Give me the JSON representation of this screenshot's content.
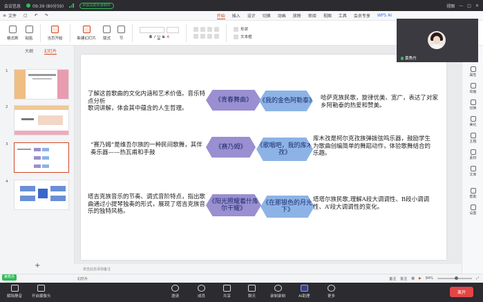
{
  "meeting": {
    "title": "会议信息",
    "time": "09:39 (80分59)",
    "status": "AI会议助手录制中",
    "view": "视图"
  },
  "menu": {
    "file": "文件",
    "tabs": [
      "开始",
      "插入",
      "设计",
      "切换",
      "动画",
      "放映",
      "审阅",
      "视图",
      "工具",
      "会员专享"
    ],
    "ai": "WPS AI"
  },
  "ribbon": {
    "paste_group": [
      "格式刷",
      "粘贴"
    ],
    "from_start": "当页开始",
    "new_slide": "新建幻灯片",
    "layout": "版式",
    "section": "节",
    "shape": "形状",
    "textbox": "文本框"
  },
  "left_panel": {
    "tabs": [
      "大纲",
      "幻灯片"
    ],
    "slides": [
      "1",
      "2",
      "3",
      "4"
    ],
    "add": "+"
  },
  "slide": {
    "rows": [
      {
        "left": "了解这首歌曲的文化内涵和艺术价值。音乐特点分析\n歌词讲解，体会其中蕴含的人生哲理。",
        "hex1": "《青春舞曲》",
        "hex2": "《我的金色阿勒泰》",
        "right": "哈萨克族民歌，旋律优美、宽广，表达了对家乡阿勒泰的热爱和赞美。"
      },
      {
        "left": "“赛乃姆”是维吾尔族的一种民间歌舞，其伴奏乐器——热瓦甫和手鼓",
        "hex1": "《赛乃姆》",
        "hex2": "《歌唱吧，我的库木孜》",
        "right": "库木孜是柯尔克孜族弹拨弦鸣乐器，鼓励学生为歌曲创编简单的舞蹈动作，体验歌舞结合的乐趣。"
      },
      {
        "left": "塔吉克族音乐的节奏、调式音阶特点，指出歌曲通过小提琴独奏的形式，展现了塔吉克族音乐的独特风格。",
        "hex1": "《阳光照耀着什库尔干耀》",
        "hex2": "《在那银色的月光下》",
        "right": "塔塔尔族民歌,理解A段大调调性、B段小调调性、A’段大调调性的变化。"
      }
    ],
    "notes_placeholder": "单击此处添加备注"
  },
  "right_rail": [
    "属性",
    "动画",
    "切换",
    "美化",
    "主题",
    "素材",
    "文库",
    "帮助",
    "设置"
  ],
  "video": {
    "name": "黄秀丹"
  },
  "status": {
    "self_name": "黄秀丹",
    "zoom": "84%",
    "slide_info": "幻灯片",
    "notes_btn": "备注",
    "comment_btn": "批注"
  },
  "toolbar": {
    "items": [
      "解除静音",
      "开启摄像头",
      "邀请",
      "成员",
      "共享",
      "聊天",
      "录制录制",
      "AI助理",
      "更多"
    ],
    "end": "离开"
  },
  "colors": {
    "accent": "#d24726",
    "hex_purple": "#9a8fd0",
    "hex_blue": "#8db3e6",
    "end_red": "#e54545",
    "green": "#2ebd59"
  }
}
